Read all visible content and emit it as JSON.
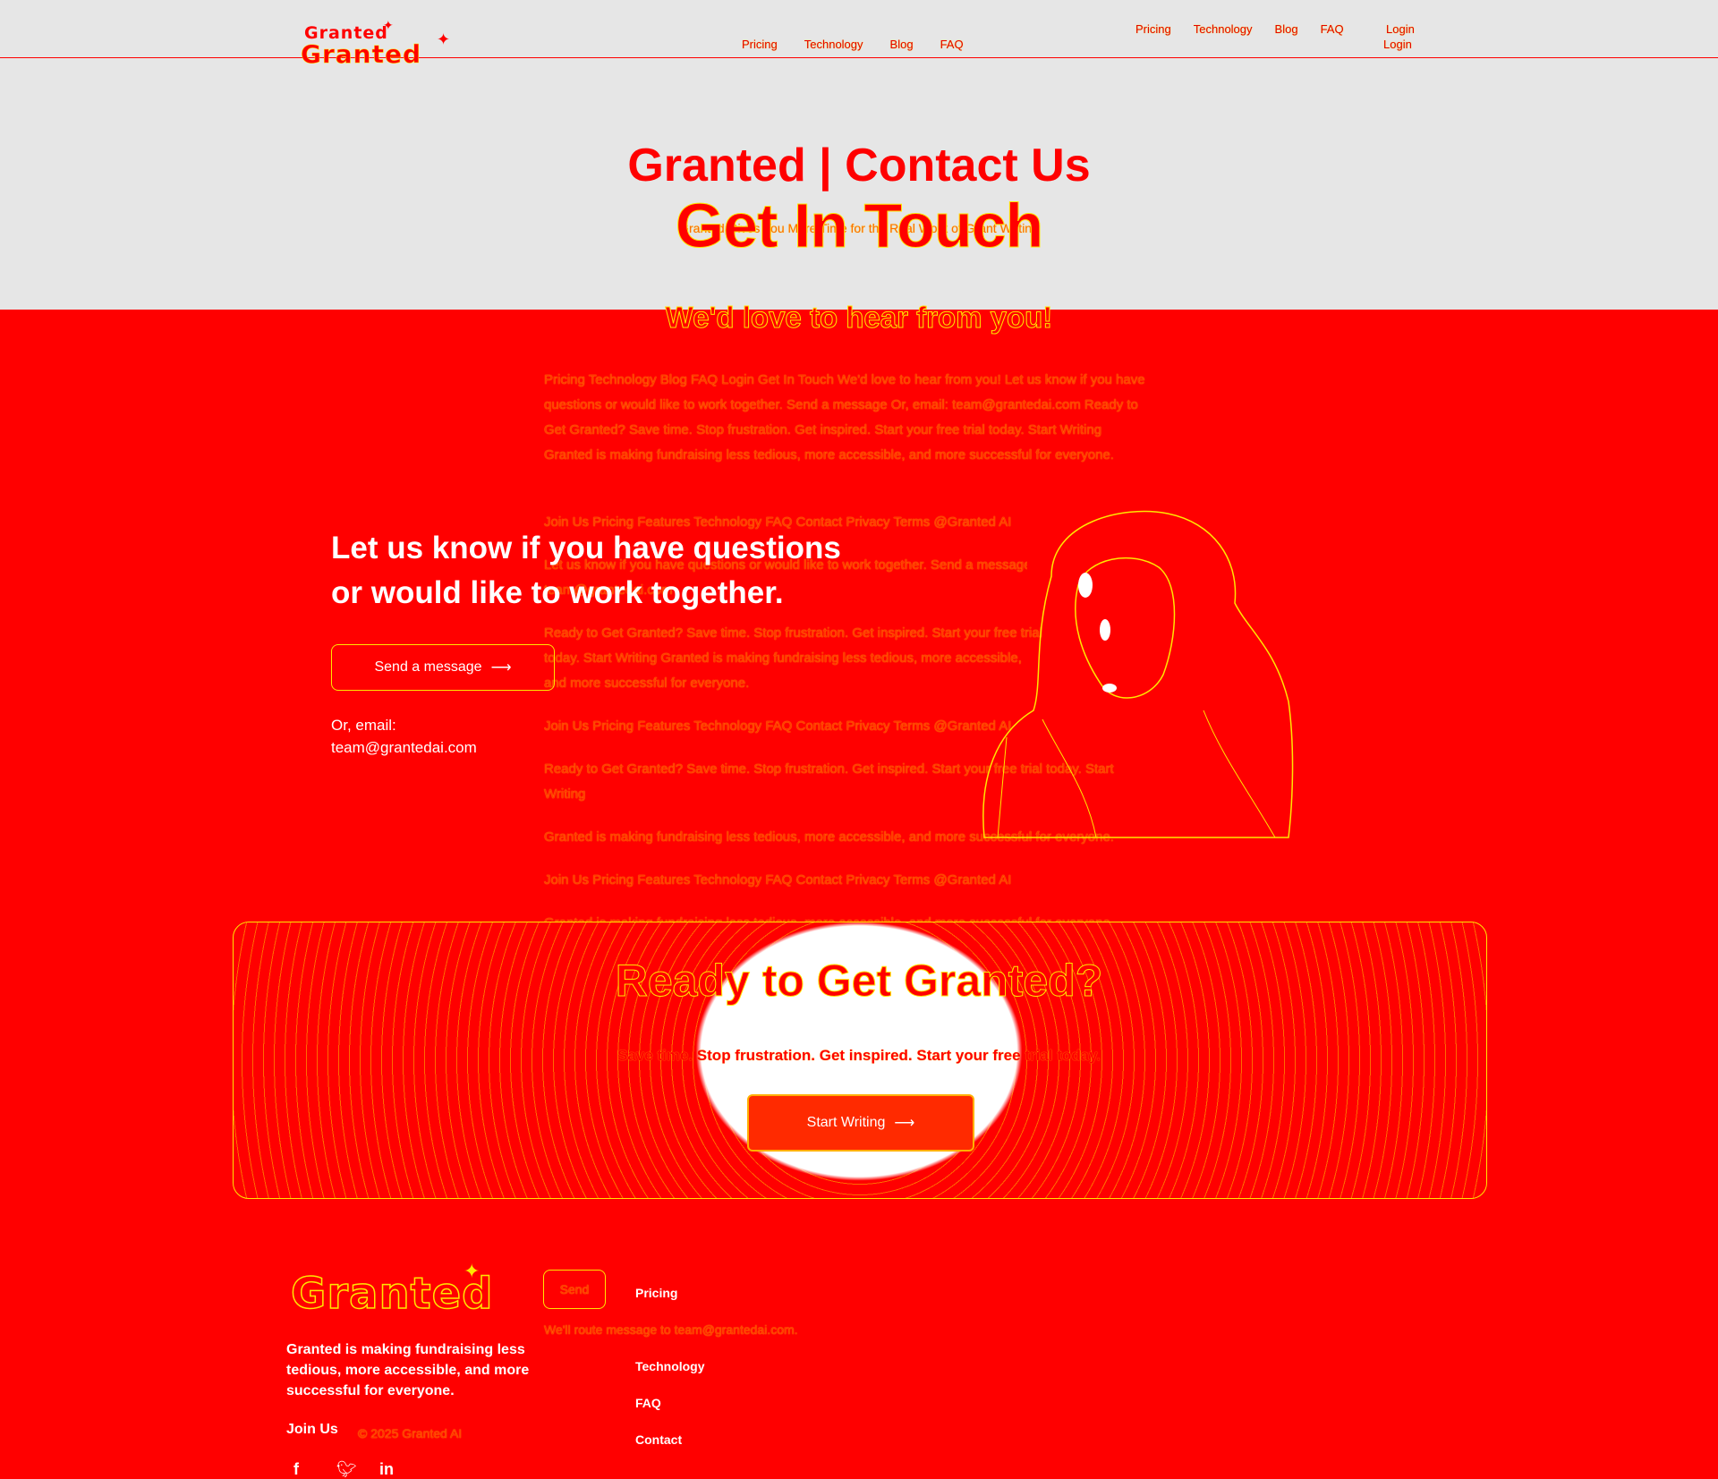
{
  "nav": {
    "logo_text": "Granted",
    "logo_text_2": "Granted",
    "links_left": [
      "Pricing",
      "Technology",
      "Blog",
      "FAQ"
    ],
    "links_right": [
      "Pricing",
      "Technology",
      "Blog",
      "FAQ"
    ],
    "login_1": "Login",
    "login_2": "Login"
  },
  "hero": {
    "title": "Granted | Contact Us",
    "subtitle_overlay": "Get In Touch",
    "meta_line": "Granted Gives You More Time for the Real Work of Grant Writing",
    "tagline": "We'd love to hear from you!"
  },
  "seo_text": {
    "p1": "Pricing Technology Blog FAQ Login Get In Touch We'd love to hear from you! Let us know if you have questions or would like to work together. Send a message Or, email: team@grantedai.com Ready to Get Granted? Save time. Stop frustration. Get inspired. Start your free trial today. Start Writing Granted is making fundraising less tedious, more accessible, and more successful for everyone.",
    "p2": "Join Us Pricing Features Technology FAQ Contact Privacy Terms @Granted AI",
    "p3": "Let us know if you have questions or would like to work together. Send a message",
    "p3b": "team@grantedai.com",
    "p4": "Ready to Get Granted? Save time. Stop frustration. Get inspired. Start your free trial today. Start Writing Granted is making fundraising less tedious, more accessible, and more successful for everyone.",
    "p5": "Join Us Pricing Features Technology FAQ Contact Privacy Terms @Granted AI",
    "p6": "Ready to Get Granted? Save time. Stop frustration. Get inspired. Start your free trial today. Start Writing",
    "p7": "Granted is making fundraising less tedious, more accessible, and more successful for everyone.",
    "p8": "Join Us Pricing Features Technology FAQ Contact Privacy Terms @Granted AI",
    "p9": "Granted is making fundraising less tedious, more accessible, and more successful for everyone."
  },
  "contact": {
    "heading_line1": "Let us know if you have questions",
    "heading_line2": "or would like to work together.",
    "send_button": "Send a message",
    "email_label": "Or, email:",
    "email": "team@grantedai.com"
  },
  "cta": {
    "heading": "Ready to Get Granted?",
    "subtext": "Save time. Stop frustration. Get inspired. Start your free trial today.",
    "button": "Start Writing"
  },
  "footer": {
    "logo_text": "Granted",
    "description": "Granted is making fundraising less tedious, more accessible, and more successful for everyone.",
    "join_us": "Join Us",
    "copyright": "© 2025 Granted AI",
    "send_label": "Send",
    "reply_note": "We'll route message to team@grantedai.com.",
    "links": [
      "Pricing",
      "Technology",
      "FAQ",
      "Contact"
    ]
  },
  "social_icons": [
    "facebook-icon",
    "twitter-icon",
    "linkedin-icon"
  ],
  "colors": {
    "background": "#ff0000",
    "top_band": "#e6e6e6",
    "accent_yellow": "#ffe600",
    "white": "#ffffff"
  }
}
